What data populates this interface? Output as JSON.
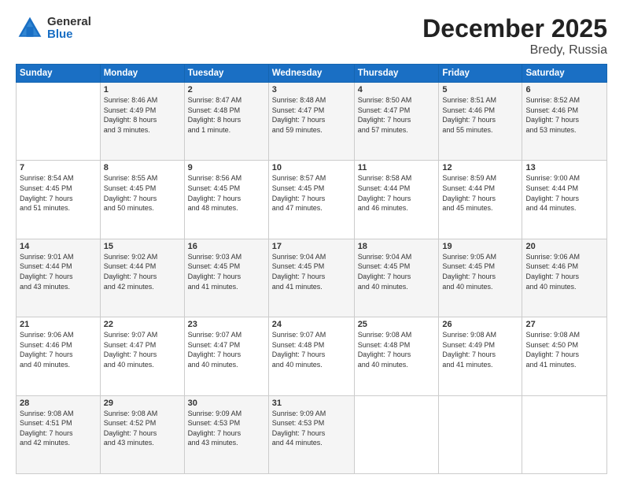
{
  "logo": {
    "general": "General",
    "blue": "Blue"
  },
  "title": "December 2025",
  "subtitle": "Bredy, Russia",
  "days_header": [
    "Sunday",
    "Monday",
    "Tuesday",
    "Wednesday",
    "Thursday",
    "Friday",
    "Saturday"
  ],
  "weeks": [
    [
      {
        "day": "",
        "info": ""
      },
      {
        "day": "1",
        "info": "Sunrise: 8:46 AM\nSunset: 4:49 PM\nDaylight: 8 hours\nand 3 minutes."
      },
      {
        "day": "2",
        "info": "Sunrise: 8:47 AM\nSunset: 4:48 PM\nDaylight: 8 hours\nand 1 minute."
      },
      {
        "day": "3",
        "info": "Sunrise: 8:48 AM\nSunset: 4:47 PM\nDaylight: 7 hours\nand 59 minutes."
      },
      {
        "day": "4",
        "info": "Sunrise: 8:50 AM\nSunset: 4:47 PM\nDaylight: 7 hours\nand 57 minutes."
      },
      {
        "day": "5",
        "info": "Sunrise: 8:51 AM\nSunset: 4:46 PM\nDaylight: 7 hours\nand 55 minutes."
      },
      {
        "day": "6",
        "info": "Sunrise: 8:52 AM\nSunset: 4:46 PM\nDaylight: 7 hours\nand 53 minutes."
      }
    ],
    [
      {
        "day": "7",
        "info": "Sunrise: 8:54 AM\nSunset: 4:45 PM\nDaylight: 7 hours\nand 51 minutes."
      },
      {
        "day": "8",
        "info": "Sunrise: 8:55 AM\nSunset: 4:45 PM\nDaylight: 7 hours\nand 50 minutes."
      },
      {
        "day": "9",
        "info": "Sunrise: 8:56 AM\nSunset: 4:45 PM\nDaylight: 7 hours\nand 48 minutes."
      },
      {
        "day": "10",
        "info": "Sunrise: 8:57 AM\nSunset: 4:45 PM\nDaylight: 7 hours\nand 47 minutes."
      },
      {
        "day": "11",
        "info": "Sunrise: 8:58 AM\nSunset: 4:44 PM\nDaylight: 7 hours\nand 46 minutes."
      },
      {
        "day": "12",
        "info": "Sunrise: 8:59 AM\nSunset: 4:44 PM\nDaylight: 7 hours\nand 45 minutes."
      },
      {
        "day": "13",
        "info": "Sunrise: 9:00 AM\nSunset: 4:44 PM\nDaylight: 7 hours\nand 44 minutes."
      }
    ],
    [
      {
        "day": "14",
        "info": "Sunrise: 9:01 AM\nSunset: 4:44 PM\nDaylight: 7 hours\nand 43 minutes."
      },
      {
        "day": "15",
        "info": "Sunrise: 9:02 AM\nSunset: 4:44 PM\nDaylight: 7 hours\nand 42 minutes."
      },
      {
        "day": "16",
        "info": "Sunrise: 9:03 AM\nSunset: 4:45 PM\nDaylight: 7 hours\nand 41 minutes."
      },
      {
        "day": "17",
        "info": "Sunrise: 9:04 AM\nSunset: 4:45 PM\nDaylight: 7 hours\nand 41 minutes."
      },
      {
        "day": "18",
        "info": "Sunrise: 9:04 AM\nSunset: 4:45 PM\nDaylight: 7 hours\nand 40 minutes."
      },
      {
        "day": "19",
        "info": "Sunrise: 9:05 AM\nSunset: 4:45 PM\nDaylight: 7 hours\nand 40 minutes."
      },
      {
        "day": "20",
        "info": "Sunrise: 9:06 AM\nSunset: 4:46 PM\nDaylight: 7 hours\nand 40 minutes."
      }
    ],
    [
      {
        "day": "21",
        "info": "Sunrise: 9:06 AM\nSunset: 4:46 PM\nDaylight: 7 hours\nand 40 minutes."
      },
      {
        "day": "22",
        "info": "Sunrise: 9:07 AM\nSunset: 4:47 PM\nDaylight: 7 hours\nand 40 minutes."
      },
      {
        "day": "23",
        "info": "Sunrise: 9:07 AM\nSunset: 4:47 PM\nDaylight: 7 hours\nand 40 minutes."
      },
      {
        "day": "24",
        "info": "Sunrise: 9:07 AM\nSunset: 4:48 PM\nDaylight: 7 hours\nand 40 minutes."
      },
      {
        "day": "25",
        "info": "Sunrise: 9:08 AM\nSunset: 4:48 PM\nDaylight: 7 hours\nand 40 minutes."
      },
      {
        "day": "26",
        "info": "Sunrise: 9:08 AM\nSunset: 4:49 PM\nDaylight: 7 hours\nand 41 minutes."
      },
      {
        "day": "27",
        "info": "Sunrise: 9:08 AM\nSunset: 4:50 PM\nDaylight: 7 hours\nand 41 minutes."
      }
    ],
    [
      {
        "day": "28",
        "info": "Sunrise: 9:08 AM\nSunset: 4:51 PM\nDaylight: 7 hours\nand 42 minutes."
      },
      {
        "day": "29",
        "info": "Sunrise: 9:08 AM\nSunset: 4:52 PM\nDaylight: 7 hours\nand 43 minutes."
      },
      {
        "day": "30",
        "info": "Sunrise: 9:09 AM\nSunset: 4:53 PM\nDaylight: 7 hours\nand 43 minutes."
      },
      {
        "day": "31",
        "info": "Sunrise: 9:09 AM\nSunset: 4:53 PM\nDaylight: 7 hours\nand 44 minutes."
      },
      {
        "day": "",
        "info": ""
      },
      {
        "day": "",
        "info": ""
      },
      {
        "day": "",
        "info": ""
      }
    ]
  ]
}
